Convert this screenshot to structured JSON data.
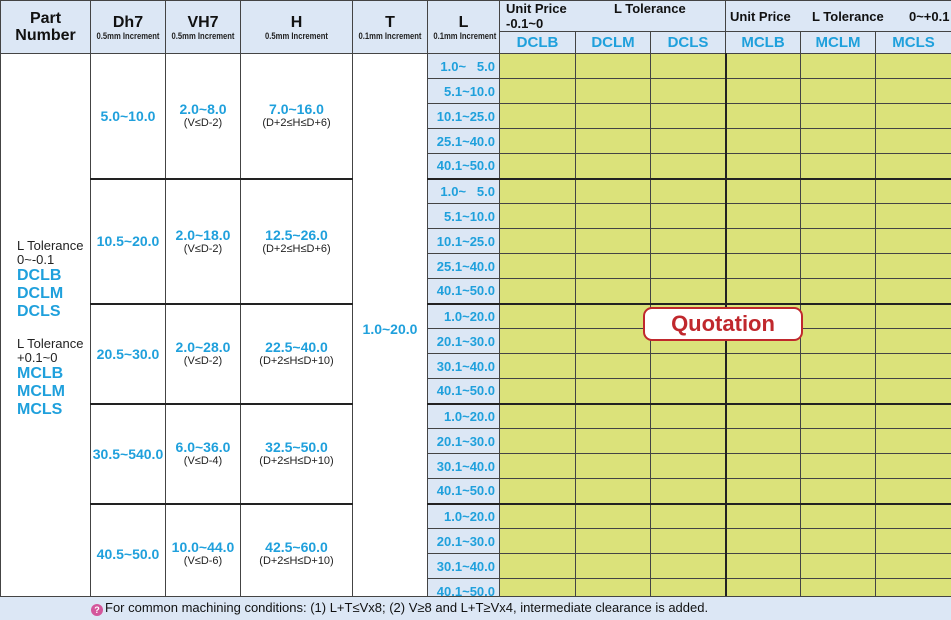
{
  "header": {
    "part_number": [
      "Part",
      "Number"
    ],
    "d": {
      "label": "Dh7",
      "increment": "0.5mm Increment"
    },
    "v": {
      "label": "VH7",
      "increment": "0.5mm Increment"
    },
    "h": {
      "label": "H",
      "increment": "0.5mm Increment"
    },
    "t": {
      "label": "T",
      "increment": "0.1mm Increment"
    },
    "l": {
      "label": "L",
      "increment": "0.1mm Increment"
    },
    "price_group_1": {
      "unit_price": "Unit Price",
      "tolerance": "L Tolerance -0.1~0"
    },
    "price_group_2": {
      "unit_price": "Unit Price",
      "tolerance": "L Tolerance",
      "tolerance_value": "0~+0.1"
    },
    "codes": [
      "DCLB",
      "DCLM",
      "DCLS",
      "MCLB",
      "MCLM",
      "MCLS"
    ]
  },
  "part_number_cell": {
    "tolerance_1": [
      "L Tolerance",
      "0~-0.1"
    ],
    "codes_1": [
      "DCLB",
      "DCLM",
      "DCLS"
    ],
    "tolerance_2": [
      "L Tolerance",
      "+0.1~0"
    ],
    "codes_2": [
      "MCLB",
      "MCLM",
      "MCLS"
    ]
  },
  "t_value": "1.0~20.0",
  "groups": [
    {
      "d": "5.0~10.0",
      "v": "2.0~8.0",
      "v_cond": "(V≤D-2)",
      "h": "7.0~16.0",
      "h_cond": "(D+2≤H≤D+6)",
      "l": [
        "1.0~   5.0",
        "5.1~10.0",
        "10.1~25.0",
        "25.1~40.0",
        "40.1~50.0"
      ]
    },
    {
      "d": "10.5~20.0",
      "v": "2.0~18.0",
      "v_cond": "(V≤D-2)",
      "h": "12.5~26.0",
      "h_cond": "(D+2≤H≤D+6)",
      "l": [
        "1.0~   5.0",
        "5.1~10.0",
        "10.1~25.0",
        "25.1~40.0",
        "40.1~50.0"
      ]
    },
    {
      "d": "20.5~30.0",
      "v": "2.0~28.0",
      "v_cond": "(V≤D-2)",
      "h": "22.5~40.0",
      "h_cond": "(D+2≤H≤D+10)",
      "l": [
        "1.0~20.0",
        "20.1~30.0",
        "30.1~40.0",
        "40.1~50.0"
      ]
    },
    {
      "d": "30.5~540.0",
      "v": "6.0~36.0",
      "v_cond": "(V≤D-4)",
      "h": "32.5~50.0",
      "h_cond": "(D+2≤H≤D+10)",
      "l": [
        "1.0~20.0",
        "20.1~30.0",
        "30.1~40.0",
        "40.1~50.0"
      ]
    },
    {
      "d": "40.5~50.0",
      "v": "10.0~44.0",
      "v_cond": "(V≤D-6)",
      "h": "42.5~60.0",
      "h_cond": "(D+2≤H≤D+10)",
      "l": [
        "1.0~20.0",
        "20.1~30.0",
        "30.1~40.0",
        "40.1~50.0"
      ]
    }
  ],
  "quotation_label": "Quotation",
  "footer_note": "For common machining conditions: (1) L+T≤Vx8; (2) V≥8 and L+T≥Vx4, intermediate clearance is added.",
  "colors": {
    "header_bg": "#dce7f5",
    "price_cell": "#dbe27a",
    "accent_blue": "#1fa0dc",
    "quotation_red": "#c0282d"
  },
  "icons": {
    "footer": "info-icon"
  }
}
